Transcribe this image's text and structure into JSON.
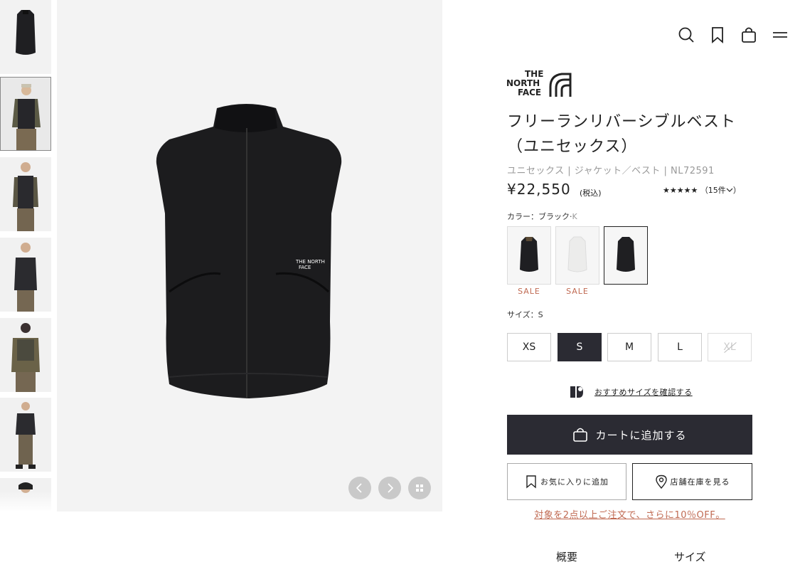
{
  "header": {
    "icons": [
      "search-icon",
      "bookmark-icon",
      "bag-icon",
      "menu-icon"
    ]
  },
  "brand": {
    "logo_lines": [
      "THE",
      "NORTH",
      "FACE"
    ]
  },
  "product": {
    "title_line1": "フリーランリバーシブルベスト",
    "title_line2": "（ユニセックス）",
    "meta": "ユニセックス | ジャケット／ベスト | NL72591",
    "price": "¥22,550",
    "tax": "(税込)",
    "stars": "★★★★★",
    "review_count": "（15件",
    "color_label": "カラー：ブラック·",
    "color_code": "K",
    "sale_label": "SALE",
    "size_label": "サイズ：S",
    "sizes": [
      "XS",
      "S",
      "M",
      "L",
      "XL"
    ],
    "size_recommend": "おすすめサイズを確認する",
    "add_to_cart": "カートに追加する",
    "favorite": "お気に入りに追加",
    "store_stock": "店舗在庫を見る",
    "promo": "対象を2点以上ご注文で、さらに10％OFF。"
  },
  "tabs": [
    "概要",
    "サイズ"
  ],
  "colors": {
    "accent_dark": "#2b2b33",
    "sale": "#c06a52",
    "gallery_bg": "#f3f3f3"
  }
}
